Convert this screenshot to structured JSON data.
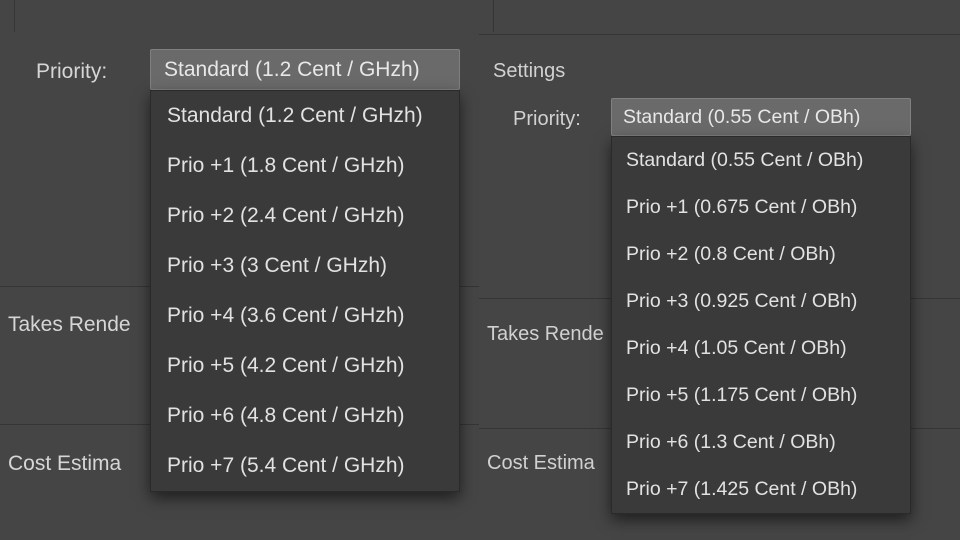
{
  "left": {
    "priority_label": "Priority:",
    "selected": "Standard (1.2 Cent / GHzh)",
    "options": [
      "Standard (1.2 Cent / GHzh)",
      "Prio +1 (1.8 Cent / GHzh)",
      "Prio +2 (2.4 Cent / GHzh)",
      "Prio +3 (3 Cent / GHzh)",
      "Prio +4 (3.6 Cent / GHzh)",
      "Prio +5 (4.2 Cent / GHzh)",
      "Prio +6 (4.8 Cent / GHzh)",
      "Prio +7 (5.4 Cent / GHzh)"
    ],
    "takes_label": "Takes Rende",
    "cost_label": "Cost Estima"
  },
  "right": {
    "settings_label": "Settings",
    "priority_label": "Priority:",
    "selected": "Standard (0.55 Cent / OBh)",
    "options": [
      "Standard (0.55 Cent / OBh)",
      "Prio +1 (0.675 Cent / OBh)",
      "Prio +2 (0.8 Cent / OBh)",
      "Prio +3 (0.925 Cent / OBh)",
      "Prio +4 (1.05 Cent / OBh)",
      "Prio +5 (1.175 Cent / OBh)",
      "Prio +6 (1.3 Cent / OBh)",
      "Prio +7 (1.425 Cent / OBh)"
    ],
    "takes_label": "Takes Rende",
    "cost_label": "Cost Estima"
  }
}
